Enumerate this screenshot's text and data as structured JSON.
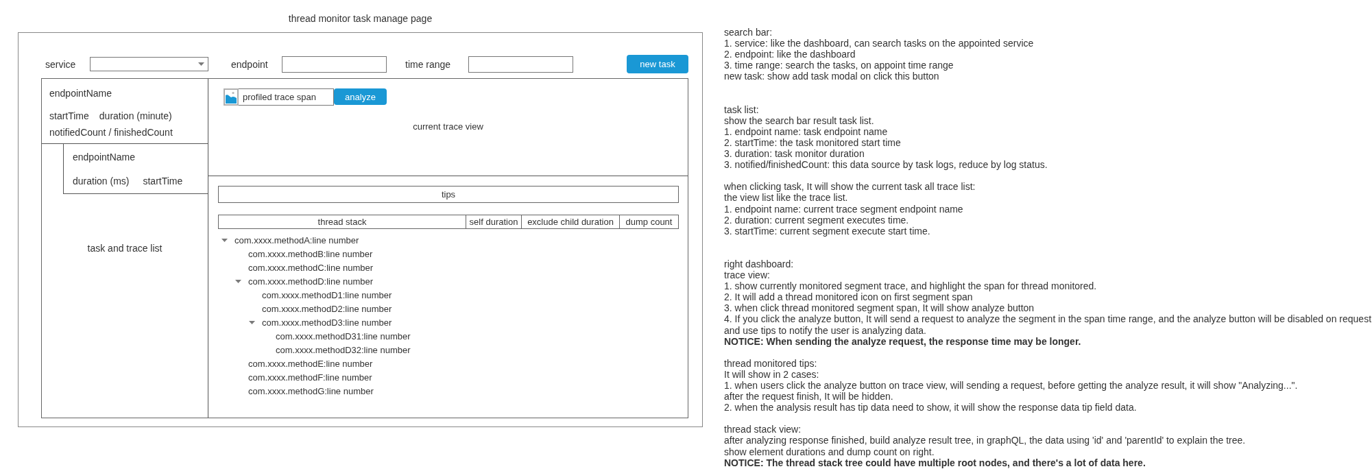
{
  "page_title": "thread monitor task manage page",
  "search_bar": {
    "service_label": "service",
    "endpoint_label": "endpoint",
    "time_range_label": "time range",
    "new_task_button": "new task"
  },
  "task_list": {
    "task": {
      "endpoint_name": "endpointName",
      "start_time": "startTime",
      "duration": "duration (minute)",
      "counts": "notifiedCount / finishedCount"
    },
    "trace": {
      "endpoint_name": "endpointName",
      "duration": "duration (ms)",
      "start_time": "startTime"
    },
    "caption": "task and trace list"
  },
  "trace_view": {
    "span": "profiled trace span",
    "analyze_button": "analyze",
    "caption": "current trace view"
  },
  "thread_stack": {
    "tips": "tips",
    "columns": [
      "thread stack",
      "self duration",
      "exclude child duration",
      "dump count"
    ],
    "tree": [
      {
        "label": "com.xxxx.methodA:line number",
        "expanded": true,
        "children": [
          {
            "label": "com.xxxx.methodB:line number"
          },
          {
            "label": "com.xxxx.methodC:line number"
          },
          {
            "label": "com.xxxx.methodD:line number",
            "expanded": true,
            "children": [
              {
                "label": "com.xxxx.methodD1:line number"
              },
              {
                "label": "com.xxxx.methodD2:line number"
              },
              {
                "label": "com.xxxx.methodD3:line number",
                "expanded": true,
                "children": [
                  {
                    "label": "com.xxxx.methodD31:line number"
                  },
                  {
                    "label": "com.xxxx.methodD32:line number"
                  }
                ]
              }
            ]
          },
          {
            "label": "com.xxxx.methodE:line number"
          },
          {
            "label": "com.xxxx.methodF:line number"
          },
          {
            "label": "com.xxxx.methodG:line number"
          }
        ]
      }
    ]
  },
  "notes": [
    {
      "paragraphs": [
        [
          {
            "text": "search bar:",
            "bold": false
          },
          {
            "text": "1. service: like the dashboard, can search tasks on the appointed service",
            "bold": false
          },
          {
            "text": "2. endpoint: like the dashboard",
            "bold": false
          },
          {
            "text": "3. time range: search the tasks, on appoint time range",
            "bold": false
          },
          {
            "text": "new task: show add task modal on click this button",
            "bold": false
          }
        ]
      ]
    },
    {
      "paragraphs": [
        [
          {
            "text": "task list:",
            "bold": false
          },
          {
            "text": "show the search bar result task list.",
            "bold": false
          },
          {
            "text": "1. endpoint name: task endpoint name",
            "bold": false
          },
          {
            "text": "2. startTime: the task monitored start time",
            "bold": false
          },
          {
            "text": "3. duration: task monitor duration",
            "bold": false
          },
          {
            "text": "3. notified/finishedCount: this data source by task logs, reduce by log status.",
            "bold": false
          }
        ],
        [
          {
            "text": "when clicking task, It will show the current task all trace list:",
            "bold": false
          },
          {
            "text": "the view list like the trace list.",
            "bold": false
          },
          {
            "text": "1. endpoint name: current trace segment endpoint name",
            "bold": false
          },
          {
            "text": "2. duration: current segment executes time.",
            "bold": false
          },
          {
            "text": "3. startTime: current segment execute start time.",
            "bold": false
          }
        ]
      ]
    },
    {
      "paragraphs": [
        [
          {
            "text": "right dashboard:",
            "bold": false
          },
          {
            "text": "trace view:",
            "bold": false
          },
          {
            "text": "1. show currently monitored segment trace, and highlight the span for thread monitored.",
            "bold": false
          },
          {
            "text": "2. It will add a thread monitored icon on first segment span",
            "bold": false
          },
          {
            "text": "3. when click thread monitored segment span, It will show analyze button",
            "bold": false
          },
          {
            "text": "4. If you click the analyze button, It will send a request to analyze the segment in the span time range, and the analyze button will be disabled on request",
            "bold": false
          },
          {
            "text": "and use tips to notify the user is analyzing data.",
            "bold": false
          },
          {
            "text": "NOTICE: When sending the analyze request, the response time may be longer.",
            "bold": true
          }
        ],
        [
          {
            "text": "thread monitored tips:",
            "bold": false
          },
          {
            "text": "It will show in 2 cases:",
            "bold": false
          },
          {
            "text": "1. when users click the analyze button on trace view, will sending a request, before getting the analyze result, it will show \"Analyzing...\".",
            "bold": false
          },
          {
            "text": "after the request finish, It will be hidden.",
            "bold": false
          },
          {
            "text": "2. when the analysis result has tip data need to show, it will show the response data tip field data.",
            "bold": false
          }
        ],
        [
          {
            "text": "thread stack view:",
            "bold": false
          },
          {
            "text": "after analyzing response finished, build analyze result tree, in graphQL, the data using 'id' and 'parentId' to explain the tree.",
            "bold": false
          },
          {
            "text": "show element durations and dump count on right.",
            "bold": false
          },
          {
            "text": "NOTICE: The thread stack tree could have multiple root nodes, and there's a lot of data here.",
            "bold": true
          }
        ]
      ]
    }
  ]
}
